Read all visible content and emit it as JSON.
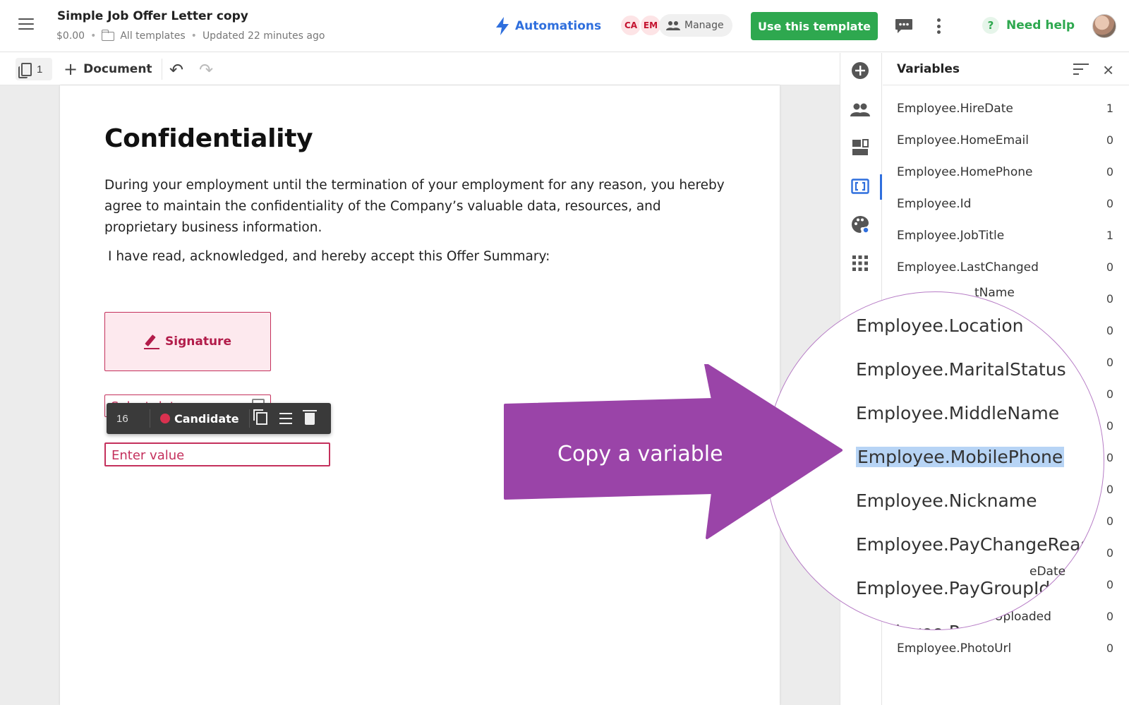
{
  "header": {
    "title": "Simple Job Offer Letter copy",
    "price": "$0.00",
    "folder": "All templates",
    "updated": "Updated 22 minutes ago",
    "automations_label": "Automations",
    "avatars": [
      "CA",
      "EM"
    ],
    "manage_label": "Manage",
    "use_template_label": "Use this template",
    "need_help_label": "Need help",
    "icons": [
      "hamburger-icon",
      "folder-icon",
      "lightning-icon",
      "people-icon",
      "chat-icon",
      "more-vertical-icon",
      "help-icon"
    ]
  },
  "toolbar": {
    "page_count": "1",
    "add_document_label": "Document",
    "icons": [
      "pages-icon",
      "plus-icon",
      "undo-icon",
      "redo-icon"
    ]
  },
  "document": {
    "heading": "Confidentiality",
    "paragraph": "During your employment until the termination of your employment for any reason, you hereby agree to maintain the confidentiality of the Company’s valuable data, resources, and proprietary business information.",
    "acceptance": "I have read, acknowledged, and hereby accept this Offer Summary:",
    "signature_label": "Signature",
    "date_placeholder": "Select date",
    "value_placeholder": "Enter value",
    "field_toolbar": {
      "font_size": "16",
      "role": "Candidate",
      "role_color": "#d9314f"
    }
  },
  "panel": {
    "title": "Variables",
    "variables": [
      {
        "name": "Employee.HireDate",
        "count": "1"
      },
      {
        "name": "Employee.HomeEmail",
        "count": "0"
      },
      {
        "name": "Employee.HomePhone",
        "count": "0"
      },
      {
        "name": "Employee.Id",
        "count": "0"
      },
      {
        "name": "Employee.JobTitle",
        "count": "1"
      },
      {
        "name": "Employee.LastChanged",
        "count": "0"
      },
      {
        "name": "",
        "count": "0"
      },
      {
        "name": "",
        "count": "0"
      },
      {
        "name": "",
        "count": "0"
      },
      {
        "name": "",
        "count": "0"
      },
      {
        "name": "",
        "count": "0"
      },
      {
        "name": "",
        "count": "0"
      },
      {
        "name": "",
        "count": "0"
      },
      {
        "name": "",
        "count": "0"
      },
      {
        "name": "",
        "count": "0"
      },
      {
        "name": "",
        "count": "0"
      },
      {
        "name": "Employee.PhotoUploaded",
        "count": "0"
      },
      {
        "name": "Employee.PhotoUrl",
        "count": "0"
      }
    ],
    "fragments": {
      "name_tail": "tName",
      "date_tail": "eDate"
    }
  },
  "magnifier": {
    "items": [
      "Employee.Location",
      "Employee.MaritalStatus",
      "Employee.MiddleName",
      "Employee.MobilePhone",
      "Employee.Nickname",
      "Employee.PayChangeReason",
      "Employee.PayGroupId",
      "Employee.PayRate"
    ],
    "highlighted": "Employee.MobilePhone"
  },
  "callout": {
    "text": "Copy a variable",
    "color": "#9a44a8"
  },
  "colors": {
    "brand_green": "#2ea84f",
    "link_blue": "#2f6fdd",
    "field_red": "#c4305c",
    "highlight": "#b7d4f5"
  }
}
